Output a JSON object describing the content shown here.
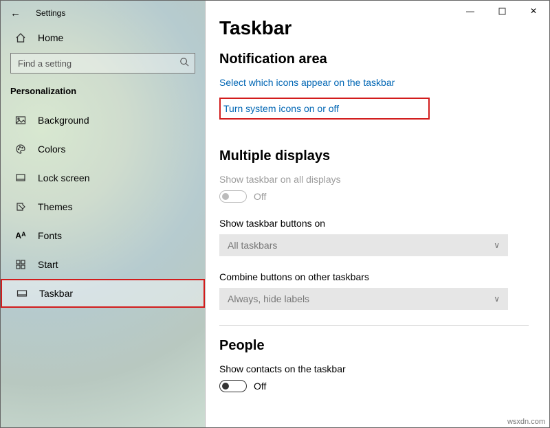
{
  "window": {
    "title": "Settings"
  },
  "sidebar": {
    "home": "Home",
    "search_placeholder": "Find a setting",
    "category": "Personalization",
    "items": [
      {
        "label": "Background"
      },
      {
        "label": "Colors"
      },
      {
        "label": "Lock screen"
      },
      {
        "label": "Themes"
      },
      {
        "label": "Fonts"
      },
      {
        "label": "Start"
      },
      {
        "label": "Taskbar"
      }
    ]
  },
  "main": {
    "heading": "Taskbar",
    "notification": {
      "title": "Notification area",
      "link1": "Select which icons appear on the taskbar",
      "link2": "Turn system icons on or off"
    },
    "multiple": {
      "title": "Multiple displays",
      "show_all_label": "Show taskbar on all displays",
      "show_all_state": "Off",
      "buttons_on_label": "Show taskbar buttons on",
      "buttons_on_value": "All taskbars",
      "combine_label": "Combine buttons on other taskbars",
      "combine_value": "Always, hide labels"
    },
    "people": {
      "title": "People",
      "contacts_label": "Show contacts on the taskbar",
      "contacts_state": "Off"
    }
  },
  "watermark": "wsxdn.com"
}
